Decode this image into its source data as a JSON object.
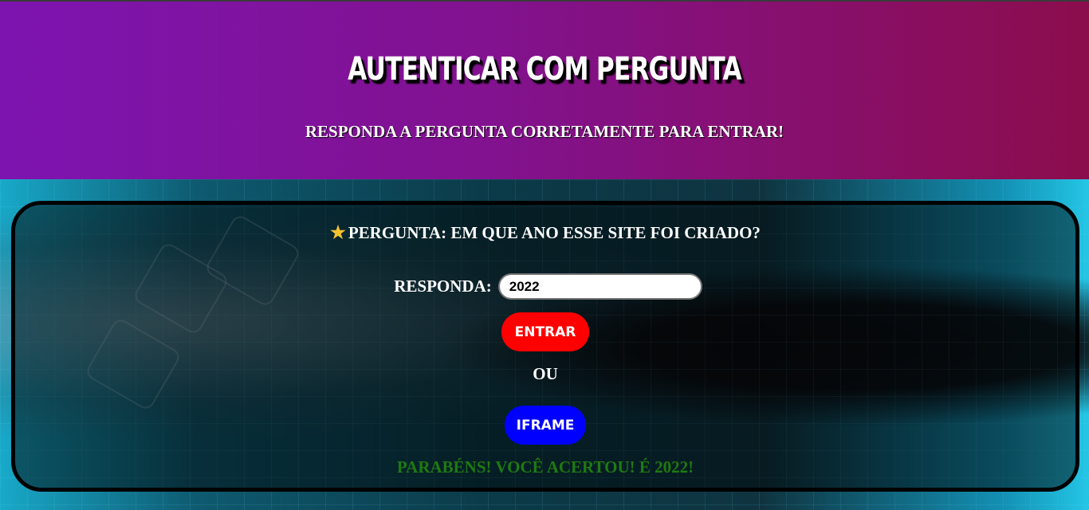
{
  "header": {
    "title": "AUTENTICAR COM PERGUNTA",
    "subtitle": "RESPONDA A PERGUNTA CORRETAMENTE PARA ENTRAR!"
  },
  "form": {
    "question_icon": "star-icon",
    "question": "PERGUNTA: EM QUE ANO ESSE SITE FOI CRIADO?",
    "answer_label": "RESPONDA:",
    "answer_value": "2022",
    "submit_label": "ENTRAR",
    "or_label": "OU",
    "iframe_label": "IFRAME",
    "result_message": "PARABÉNS! VOCÊ ACERTOU! É 2022!"
  },
  "colors": {
    "header_gradient_start": "#7d14b0",
    "header_gradient_end": "#8c0d4d",
    "submit_button": "#ff0000",
    "iframe_button": "#0000ff",
    "success_text": "#1e7a12",
    "star": "#f4c430"
  }
}
